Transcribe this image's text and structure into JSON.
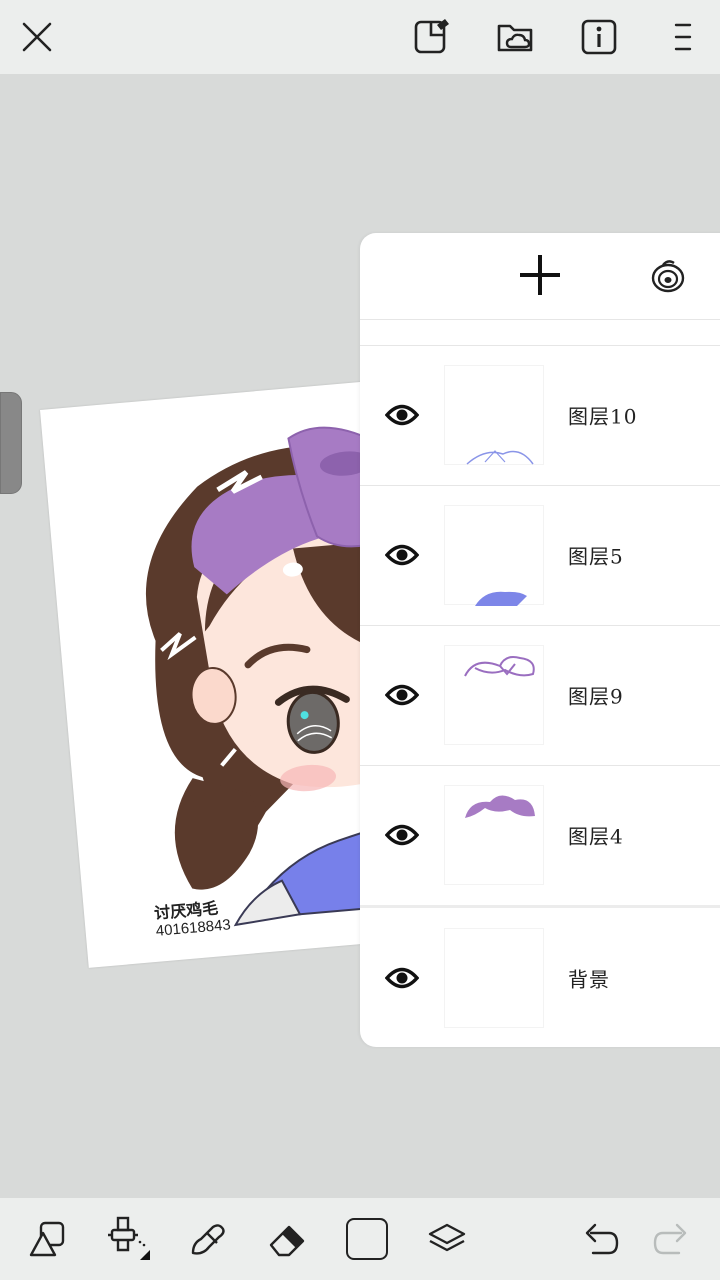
{
  "colors": {
    "background": "#d8dad9",
    "bar": "#eceeed",
    "panel": "#ffffff",
    "current_color": "#ffffff",
    "hair": "#5a3a2c",
    "bow": "#a77bc4",
    "collar": "#7780ea"
  },
  "topbar": {
    "icons": [
      "close-icon",
      "new-canvas-icon",
      "cloud-folder-icon",
      "info-icon",
      "menu-icon"
    ]
  },
  "artwork": {
    "signature_name": "讨厌鸡毛",
    "signature_number": "401618843"
  },
  "layer_panel": {
    "add_icon": "plus-icon",
    "blend_icon": "spiral-icon",
    "layers": [
      {
        "name": "图层10",
        "visible": true
      },
      {
        "name": "图层5",
        "visible": true
      },
      {
        "name": "图层9",
        "visible": true
      },
      {
        "name": "图层4",
        "visible": true
      },
      {
        "name": "背景",
        "visible": true
      }
    ]
  },
  "bottombar": {
    "tools": [
      "shapes-icon",
      "airbrush-icon",
      "smudge-icon",
      "eraser-icon",
      "color-swatch",
      "layers-icon",
      "undo-icon",
      "redo-icon"
    ]
  }
}
